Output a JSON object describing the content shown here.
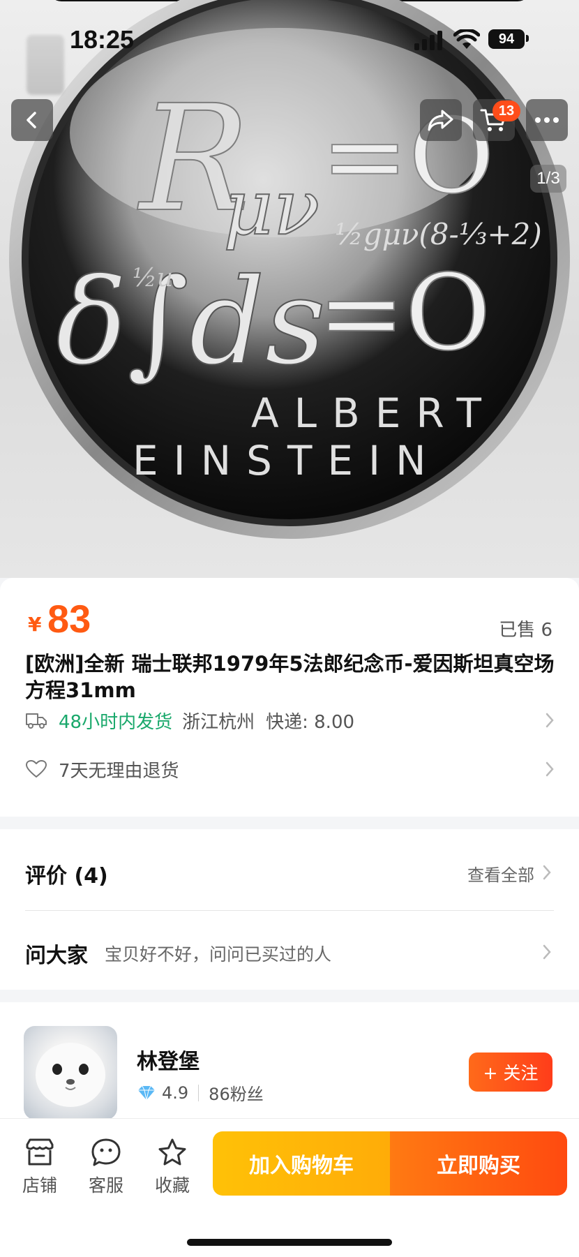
{
  "status_bar": {
    "time": "18:25",
    "battery": "94"
  },
  "gallery": {
    "pager": "1/3",
    "cart_count": "13",
    "coin": {
      "equation_1": "R",
      "equation_1_sub": "μν",
      "equation_1_rhs": "=O",
      "equation_2": "δ∫ds",
      "equation_2_rhs": "=O",
      "small_formula_1": "½gμν(8-⅓+2)",
      "small_formula_2": "½u",
      "name_line_1": "ALBERT",
      "name_line_2": "EINSTEIN"
    }
  },
  "product": {
    "currency": "¥",
    "price": "83",
    "sold": "已售 6",
    "title": "[欧洲]全新 瑞士联邦1979年5法郎纪念币-爱因斯坦真空场方程31mm",
    "shipping_time": "48小时内发货",
    "location": "浙江杭州",
    "express": "快递: 8.00",
    "return_policy": "7天无理由退货"
  },
  "reviews": {
    "label": "评价 (4)",
    "view_all": "查看全部",
    "ask_label": "问大家",
    "ask_sub": "宝贝好不好，问问已买过的人"
  },
  "shop": {
    "name": "林登堡",
    "rating": "4.9",
    "fans": "86粉丝",
    "follow_label": "+ 关注"
  },
  "bottom_bar": {
    "shop_label": "店铺",
    "service_label": "客服",
    "favorite_label": "收藏",
    "add_cart_label": "加入购物车",
    "buy_now_label": "立即购买"
  }
}
